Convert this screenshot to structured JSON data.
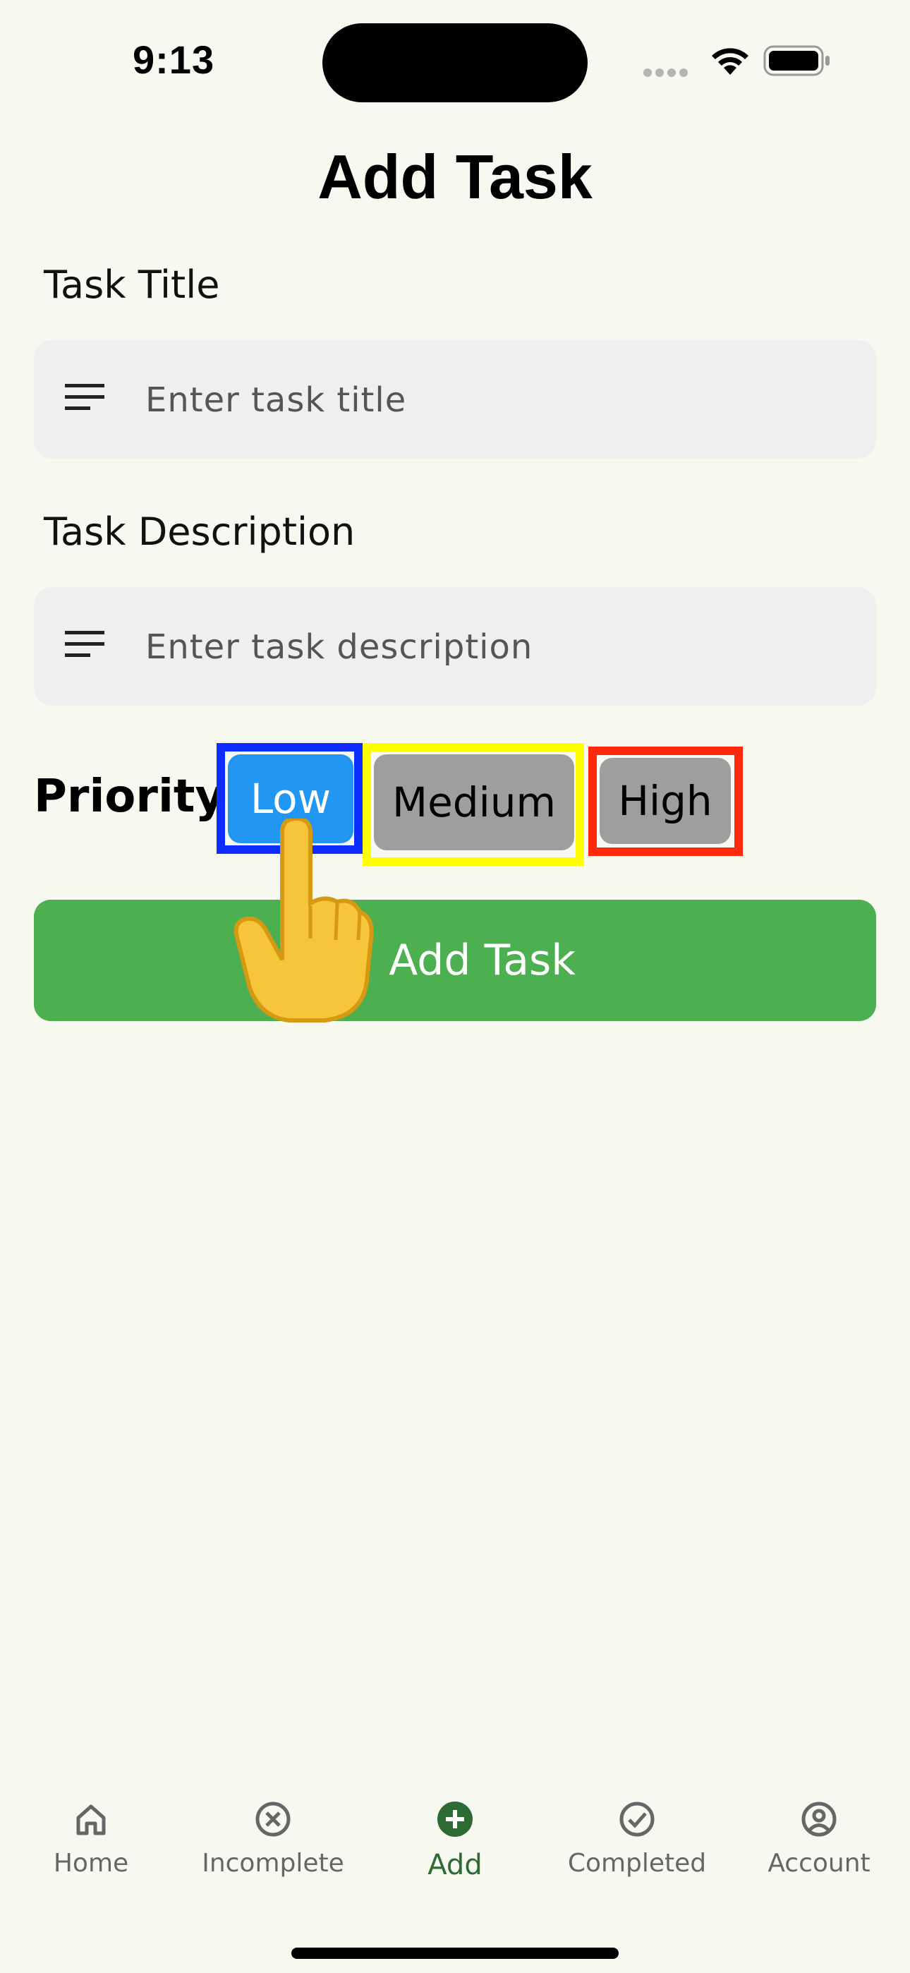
{
  "status_bar": {
    "time": "9:13"
  },
  "page": {
    "title": "Add Task"
  },
  "form": {
    "title_label": "Task Title",
    "title_placeholder": "Enter task title",
    "description_label": "Task Description",
    "description_placeholder": "Enter task description",
    "priority_label": "Priority",
    "priority_options": [
      {
        "label": "Low",
        "selected": true,
        "fill": "#2196f3",
        "frame": "#0d2cff",
        "text_color": "#ffffff"
      },
      {
        "label": "Medium",
        "selected": false,
        "fill": "#9e9e9e",
        "frame": "#ffff00",
        "text_color": "#000000"
      },
      {
        "label": "High",
        "selected": false,
        "fill": "#9e9e9e",
        "frame": "#ff2a0a",
        "text_color": "#000000"
      }
    ],
    "submit_icon": "plus-icon",
    "submit_label": "Add Task",
    "submit_color": "#4caf50"
  },
  "tabs": [
    {
      "label": "Home",
      "icon": "home-icon",
      "active": false
    },
    {
      "label": "Incomplete",
      "icon": "x-circle-icon",
      "active": false
    },
    {
      "label": "Add",
      "icon": "add-circle-icon",
      "active": true
    },
    {
      "label": "Completed",
      "icon": "check-circle-icon",
      "active": false
    },
    {
      "label": "Account",
      "icon": "account-circle-icon",
      "active": false
    }
  ],
  "overlay": {
    "pointer": "pointing-hand-icon"
  }
}
